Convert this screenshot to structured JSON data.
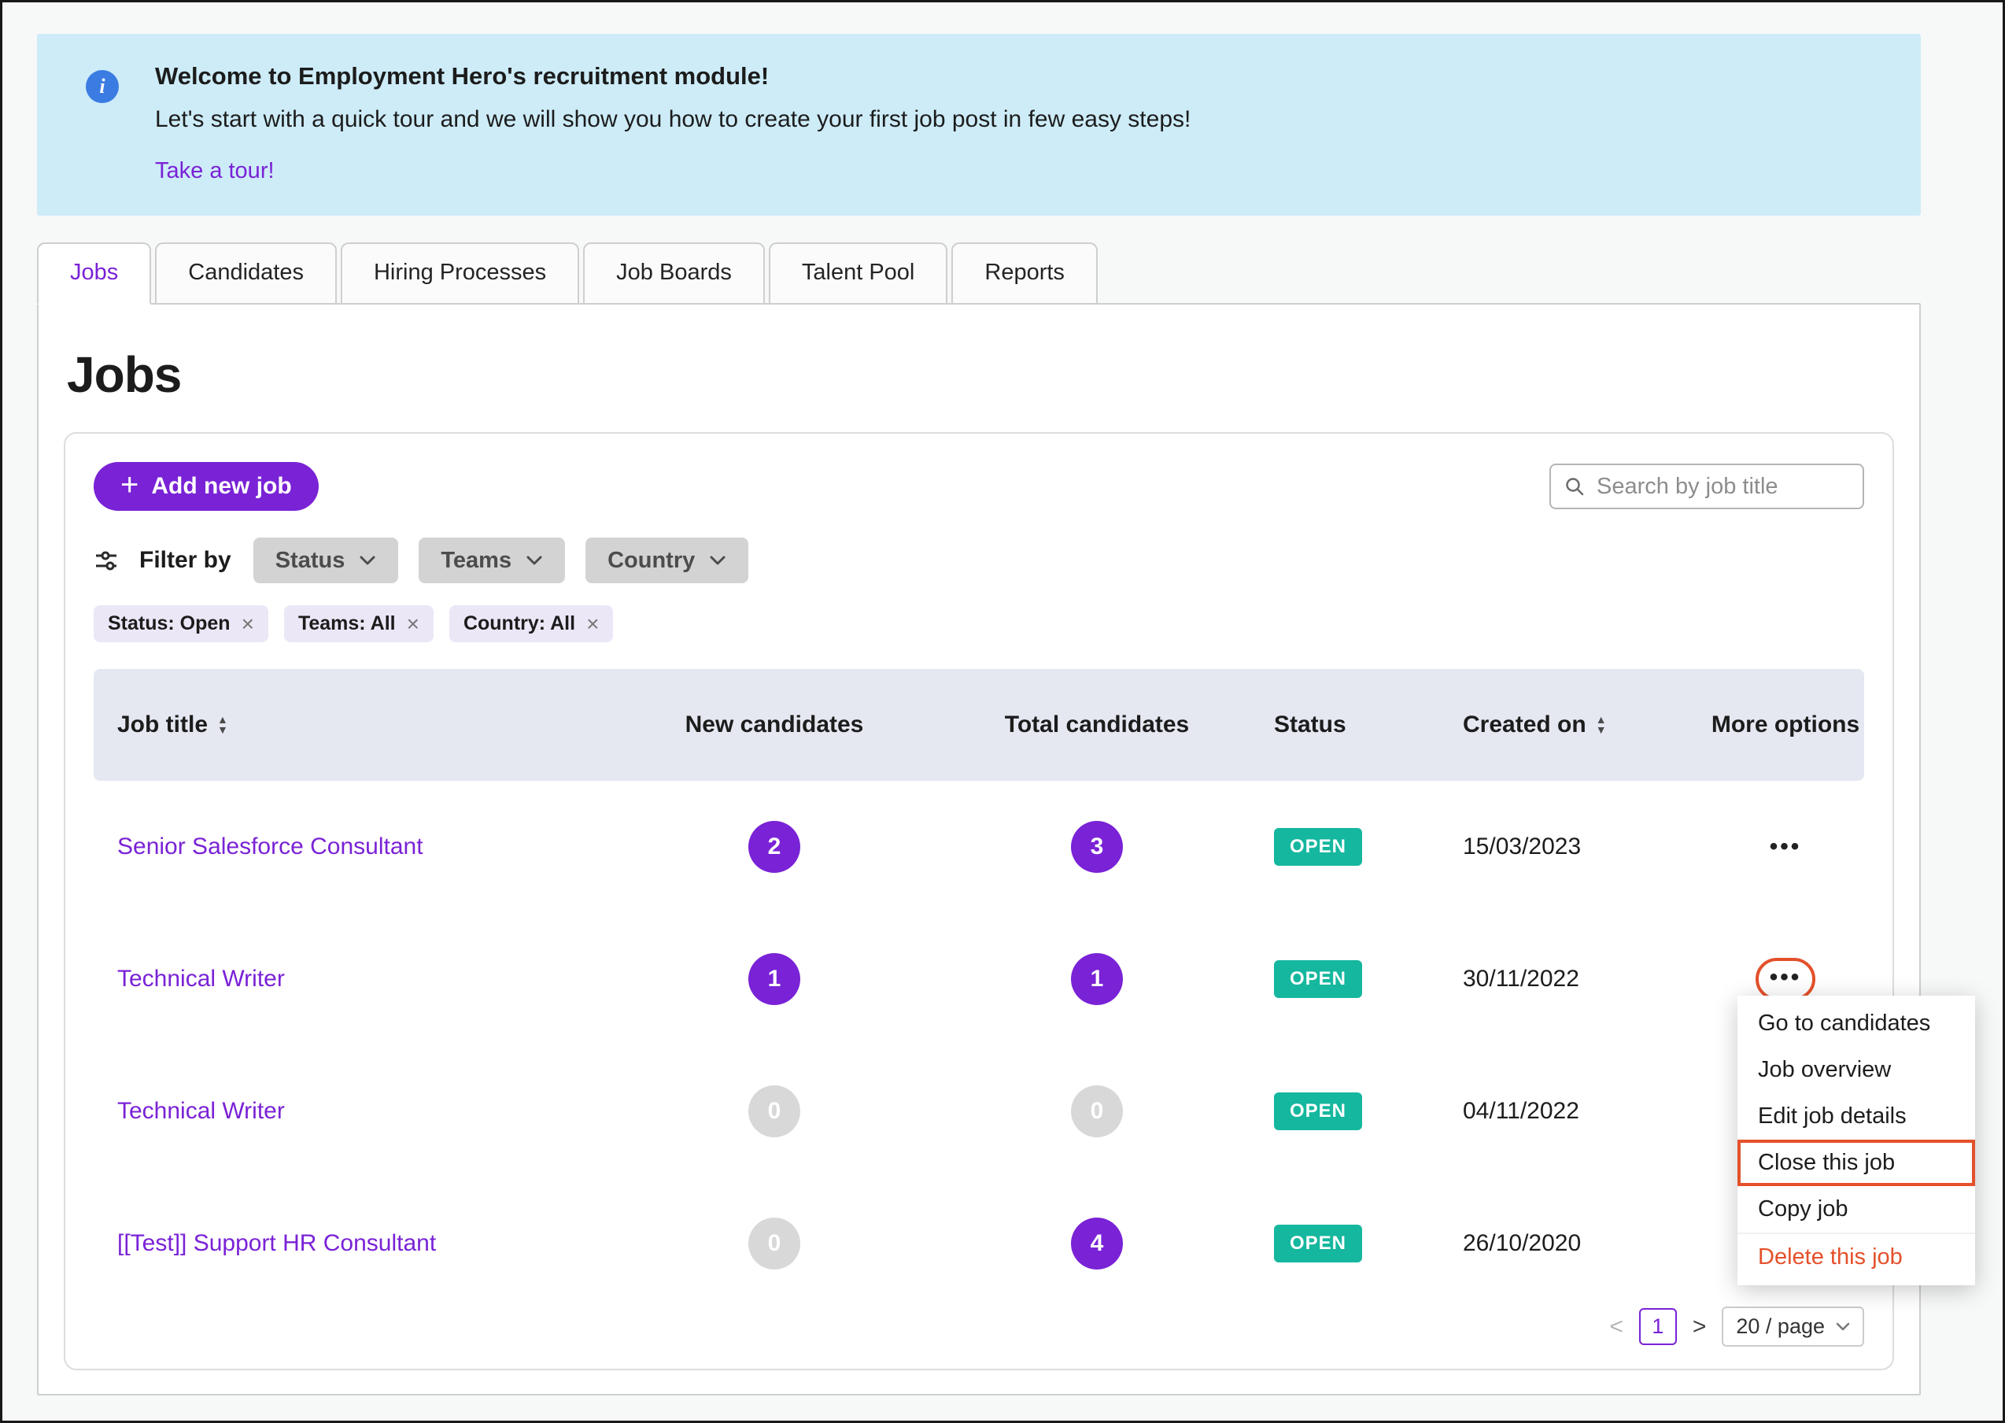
{
  "colors": {
    "accent": "#7a22d6",
    "teal": "#15b79e",
    "danger": "#e4502a",
    "banner": "#cdecf8",
    "info": "#3b7ce2"
  },
  "banner": {
    "info_glyph": "i",
    "title": "Welcome to Employment Hero's recruitment module!",
    "subtitle": "Let's start with a quick tour and we will show you how to create your first job post in few easy steps!",
    "link": "Take a tour!"
  },
  "tabs": [
    "Jobs",
    "Candidates",
    "Hiring Processes",
    "Job Boards",
    "Talent Pool",
    "Reports"
  ],
  "page": {
    "title": "Jobs"
  },
  "toolbar": {
    "add_button": "Add new job",
    "search_placeholder": "Search by job title",
    "filter_label": "Filter by",
    "filters": [
      "Status",
      "Teams",
      "Country"
    ],
    "chips": [
      "Status: Open",
      "Teams: All",
      "Country: All"
    ]
  },
  "table": {
    "headers": {
      "job_title": "Job title",
      "new_candidates": "New candidates",
      "total_candidates": "Total candidates",
      "status": "Status",
      "created_on": "Created on",
      "more_options": "More options"
    },
    "rows": [
      {
        "title": "Senior Salesforce Consultant",
        "new_count": "2",
        "new_variant": "purple",
        "total_count": "3",
        "total_variant": "purple",
        "status": "OPEN",
        "created": "15/03/2023"
      },
      {
        "title": "Technical Writer",
        "new_count": "1",
        "new_variant": "purple",
        "total_count": "1",
        "total_variant": "purple",
        "status": "OPEN",
        "created": "30/11/2022"
      },
      {
        "title": "Technical Writer",
        "new_count": "0",
        "new_variant": "gray",
        "total_count": "0",
        "total_variant": "gray",
        "status": "OPEN",
        "created": "04/11/2022"
      },
      {
        "title": "[[Test]] Support HR Consultant",
        "new_count": "0",
        "new_variant": "gray",
        "total_count": "4",
        "total_variant": "purple",
        "status": "OPEN",
        "created": "26/10/2020"
      }
    ]
  },
  "menu": {
    "items": [
      "Go to candidates",
      "Job overview",
      "Edit job details",
      "Close this job",
      "Copy job",
      "Delete this job"
    ]
  },
  "pagination": {
    "prev": "<",
    "page": "1",
    "next": ">",
    "page_size": "20 / page"
  },
  "icons": {
    "close": "×",
    "plus": "+",
    "dots": "•••",
    "sort_up": "▲",
    "sort_down": "▼"
  }
}
